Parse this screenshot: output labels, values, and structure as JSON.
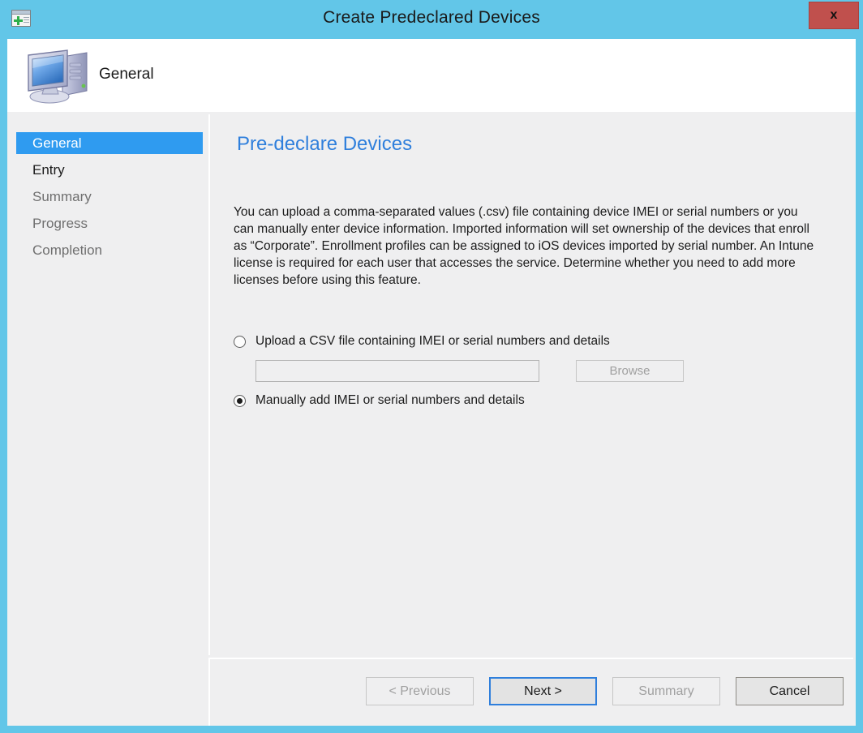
{
  "window": {
    "title": "Create Predeclared Devices",
    "titlebar_icon": "new-window-add-icon",
    "close_label": "x",
    "accent_color": "#62c6e8",
    "close_color": "#c0504d"
  },
  "header": {
    "icon": "computer-icon",
    "label": "General"
  },
  "sidebar": {
    "items": [
      {
        "label": "General",
        "state": "selected"
      },
      {
        "label": "Entry",
        "state": "upcoming"
      },
      {
        "label": "Summary",
        "state": "disabled"
      },
      {
        "label": "Progress",
        "state": "disabled"
      },
      {
        "label": "Completion",
        "state": "disabled"
      }
    ],
    "selected_color": "#2f9bf0"
  },
  "content": {
    "heading": "Pre-declare Devices",
    "heading_color": "#2f7fdc",
    "paragraph": "You can upload a comma-separated values (.csv) file containing device IMEI or serial numbers or you can manually enter device information.  Imported information will set ownership of the devices that enroll as “Corporate”.  Enrollment profiles can be assigned to iOS devices imported by serial number.  An Intune license is required for each user that accesses the service.  Determine whether you need to add more licenses before using this feature.",
    "options": {
      "upload": {
        "label": "Upload a CSV file containing IMEI or serial numbers and details",
        "selected": false,
        "path_value": "",
        "path_placeholder": "",
        "browse_label": "Browse"
      },
      "manual": {
        "label": "Manually add IMEI or serial numbers and details",
        "selected": true
      }
    }
  },
  "footer": {
    "buttons": [
      {
        "label": "< Previous",
        "state": "disabled"
      },
      {
        "label": "Next >",
        "state": "default"
      },
      {
        "label": "Summary",
        "state": "disabled"
      },
      {
        "label": "Cancel",
        "state": "enabled"
      }
    ]
  }
}
